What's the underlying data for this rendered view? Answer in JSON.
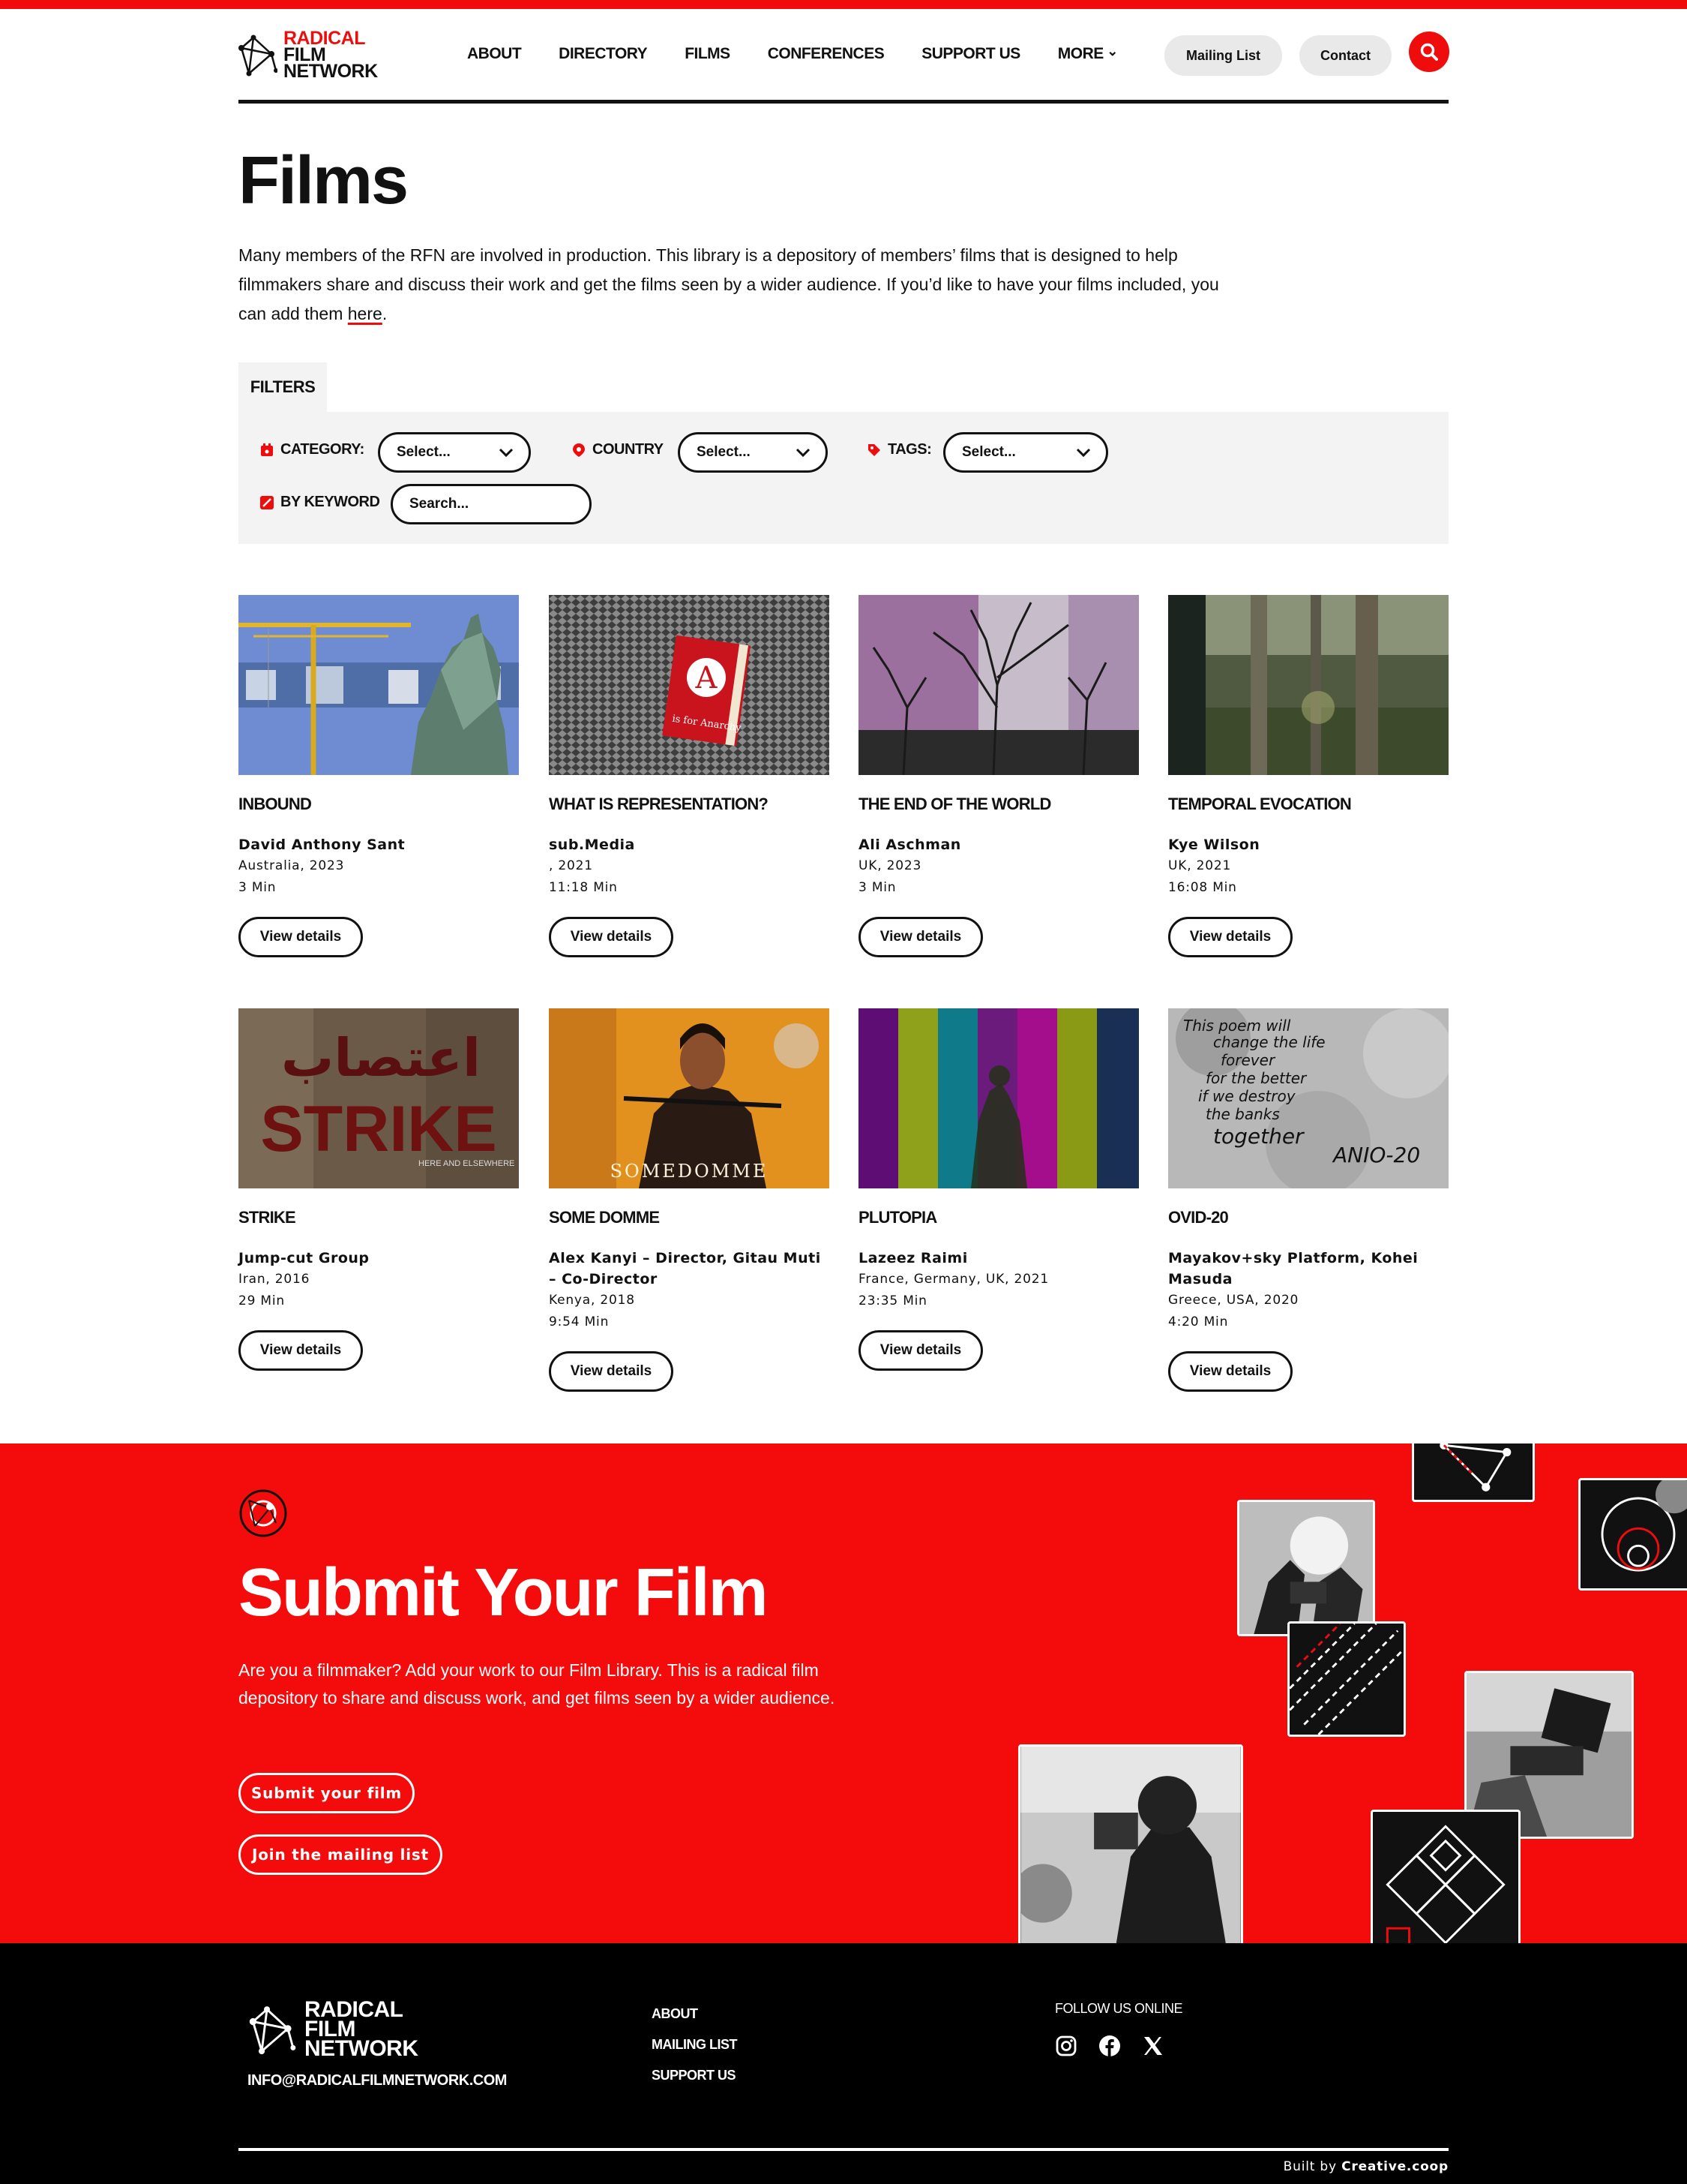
{
  "brand": {
    "line1": "RADICAL",
    "line2": "FILM",
    "line3": "NETWORK",
    "accent_color": "#ea0f0f"
  },
  "nav": {
    "items": [
      "ABOUT",
      "DIRECTORY",
      "FILMS",
      "CONFERENCES",
      "SUPPORT US",
      "MORE"
    ],
    "mailing_list": "Mailing List",
    "contact": "Contact",
    "search_icon": "search-icon"
  },
  "page": {
    "title": "Films",
    "intro_before": "Many members of the RFN are involved in production. This library is a depository of members’ films that is designed to help filmmakers share and discuss their work and get the films seen by a wider audience. If you’d like to have your films included, you can add them ",
    "intro_link": "here",
    "intro_after": "."
  },
  "filters": {
    "tab": "FILTERS",
    "category_label": "CATEGORY:",
    "category_value": "Select...",
    "country_label": "COUNTRY",
    "country_value": "Select...",
    "tags_label": "TAGS:",
    "tags_value": "Select...",
    "keyword_label": "BY KEYWORD",
    "keyword_placeholder": "Search..."
  },
  "films": [
    {
      "title": "INBOUND",
      "author": "David Anthony Sant",
      "origin": "Australia, 2023",
      "duration": "3 Min",
      "button": "View details"
    },
    {
      "title": "WHAT IS REPRESENTATION?",
      "author": "sub.Media",
      "origin": ", 2021",
      "duration": "11:18 Min",
      "button": "View details"
    },
    {
      "title": "THE END OF THE WORLD",
      "author": "Ali Aschman",
      "origin": "UK, 2023",
      "duration": "3 Min",
      "button": "View details"
    },
    {
      "title": "TEMPORAL EVOCATION",
      "author": "Kye Wilson",
      "origin": "UK, 2021",
      "duration": "16:08 Min",
      "button": "View details"
    },
    {
      "title": "STRIKE",
      "author": "Jump-cut Group",
      "origin": "Iran, 2016",
      "duration": "29 Min",
      "button": "View details"
    },
    {
      "title": "SOME DOMME",
      "author": "Alex Kanyi – Director, Gitau Muti – Co-Director",
      "origin": "Kenya, 2018",
      "duration": "9:54 Min",
      "button": "View details"
    },
    {
      "title": "PLUTOPIA",
      "author": "Lazeez Raimi",
      "origin": "France, Germany, UK, 2021",
      "duration": "23:35 Min",
      "button": "View details"
    },
    {
      "title": "OVID-20",
      "author": "Mayakov+sky Platform, Kohei Masuda",
      "origin": "Greece, USA, 2020",
      "duration": "4:20 Min",
      "button": "View details"
    }
  ],
  "thumb_text": {
    "anarchy_letter": "A",
    "anarchy_caption": "is for Anarchy",
    "strike_arabic": "اعتصاب",
    "strike_word": "STRIKE",
    "strike_small": "HERE AND ELSEWHERE",
    "somedomme": "SOMEDOMME",
    "ovid_lines": [
      "This poem will",
      "change the life",
      "forever",
      "for the better",
      "if we destroy",
      "the banks",
      "together",
      "ANIO-20"
    ]
  },
  "submit": {
    "title": "Submit Your Film",
    "text": "Are you a filmmaker? Add your work to our Film Library. This is a radical film depository to share and discuss work, and get films seen by a wider audience.",
    "submit_button": "Submit your film",
    "mailing_button": "Join the mailing list",
    "bg_color": "#f40b0b"
  },
  "footer": {
    "email": "INFO@RADICALFILMNETWORK.COM",
    "links": [
      "ABOUT",
      "MAILING LIST",
      "SUPPORT US"
    ],
    "follow": "FOLLOW US ONLINE",
    "social": [
      "instagram-icon",
      "facebook-icon",
      "x-icon"
    ],
    "built_by_prefix": "Built by",
    "built_by_name": "Creative.coop"
  }
}
